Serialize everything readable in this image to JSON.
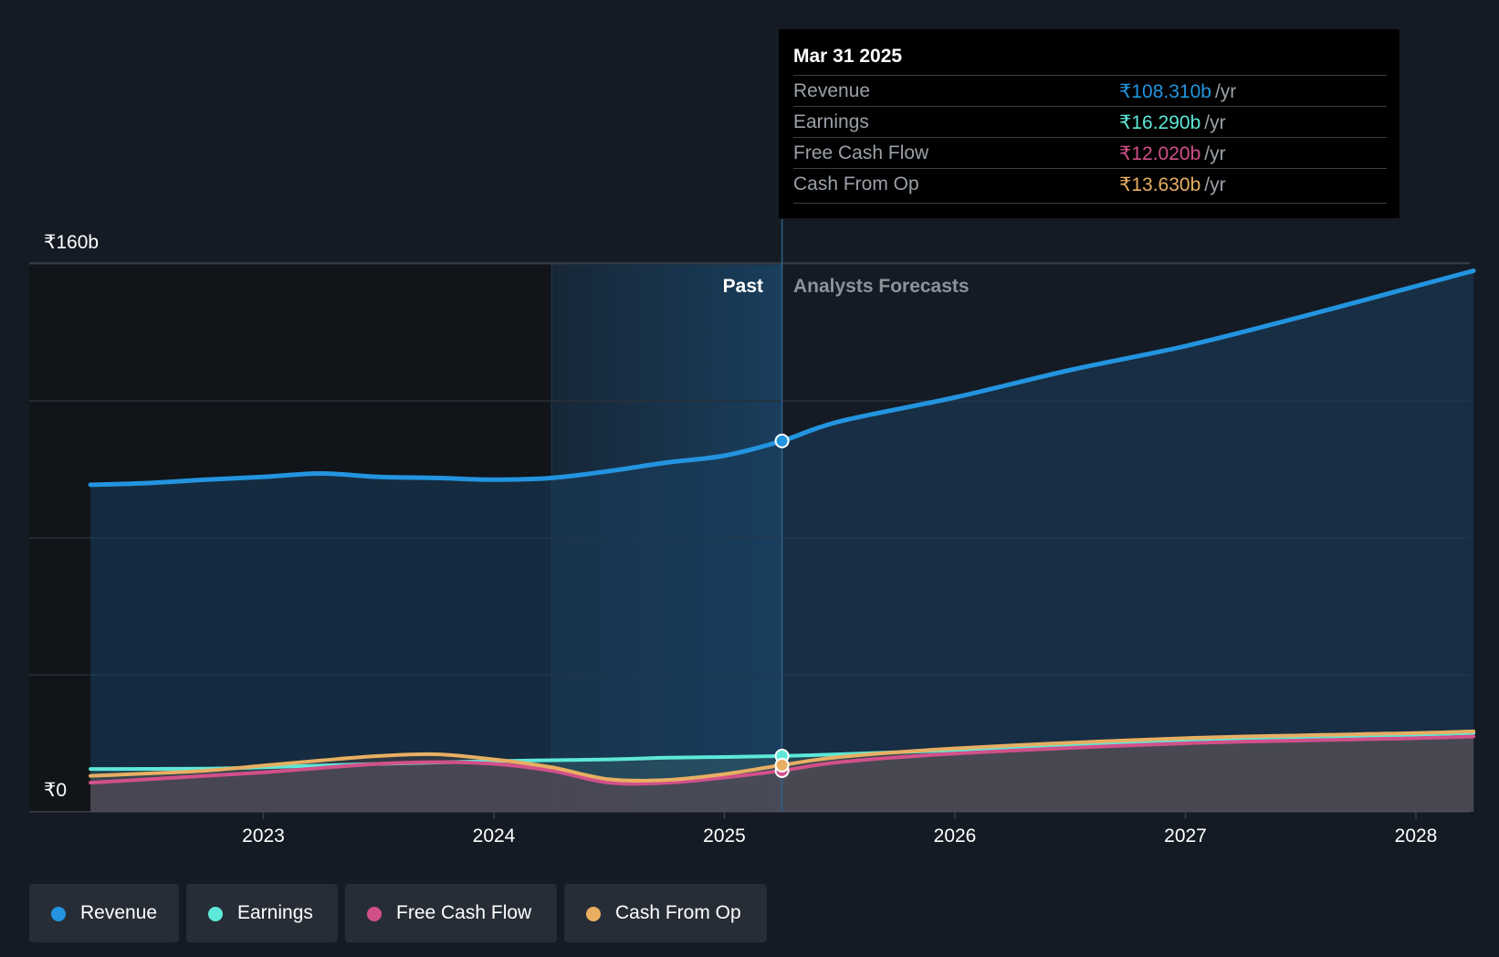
{
  "colors": {
    "revenue": "#2394df",
    "earnings": "#5ee8d9",
    "free_cash_flow": "#d2508a",
    "cash_from_op": "#e8af62",
    "background": "#151b24"
  },
  "tooltip": {
    "date": "Mar 31 2025",
    "rows": [
      {
        "label": "Revenue",
        "value": "₹108.310b",
        "unit": "/yr"
      },
      {
        "label": "Earnings",
        "value": "₹16.290b",
        "unit": "/yr"
      },
      {
        "label": "Free Cash Flow",
        "value": "₹12.020b",
        "unit": "/yr"
      },
      {
        "label": "Cash From Op",
        "value": "₹13.630b",
        "unit": "/yr"
      }
    ]
  },
  "sections": {
    "past": "Past",
    "forecast": "Analysts Forecasts"
  },
  "legend": [
    {
      "label": "Revenue"
    },
    {
      "label": "Earnings"
    },
    {
      "label": "Free Cash Flow"
    },
    {
      "label": "Cash From Op"
    }
  ],
  "chart_data": {
    "type": "area",
    "ylim": [
      0,
      160
    ],
    "y_tick_labels": [
      "₹0",
      "₹160b"
    ],
    "x_tick_labels": [
      "2023",
      "2024",
      "2025",
      "2026",
      "2027",
      "2028"
    ],
    "x_ticks": [
      2023,
      2024,
      2025,
      2026,
      2027,
      2028
    ],
    "xlim": [
      2022.0,
      2028.25
    ],
    "past_highlight_start": 2024.25,
    "divider": 2025.25,
    "grid": true,
    "legend_position": "bottom-left",
    "series": [
      {
        "name": "Revenue",
        "x": [
          2022.25,
          2022.5,
          2022.75,
          2023.0,
          2023.25,
          2023.5,
          2023.75,
          2024.0,
          2024.25,
          2024.5,
          2024.75,
          2025.0,
          2025.25,
          2025.5,
          2026.0,
          2026.5,
          2027.0,
          2027.5,
          2028.0,
          2028.25
        ],
        "y": [
          95.5,
          96.0,
          97.0,
          97.8,
          98.8,
          97.8,
          97.5,
          97.0,
          97.5,
          99.5,
          102.0,
          104.0,
          108.3,
          114.0,
          121.0,
          129.0,
          136.0,
          144.5,
          153.5,
          158.0
        ]
      },
      {
        "name": "Earnings",
        "x": [
          2022.25,
          2022.75,
          2023.0,
          2023.5,
          2024.0,
          2024.5,
          2024.75,
          2025.0,
          2025.25,
          2025.5,
          2026.0,
          2027.0,
          2028.0,
          2028.25
        ],
        "y": [
          12.5,
          12.6,
          13.0,
          14.0,
          14.8,
          15.3,
          15.8,
          16.0,
          16.29,
          16.8,
          18.0,
          20.5,
          22.5,
          23.0
        ]
      },
      {
        "name": "Free Cash Flow",
        "x": [
          2022.25,
          2022.5,
          2022.75,
          2023.0,
          2023.25,
          2023.5,
          2023.75,
          2024.0,
          2024.25,
          2024.5,
          2024.75,
          2025.0,
          2025.25,
          2025.5,
          2026.0,
          2027.0,
          2028.0,
          2028.25
        ],
        "y": [
          8.5,
          9.5,
          10.5,
          11.5,
          12.8,
          14.0,
          14.5,
          14.0,
          12.0,
          8.5,
          8.5,
          10.0,
          12.02,
          14.5,
          17.0,
          20.0,
          21.5,
          22.0
        ]
      },
      {
        "name": "Cash From Op",
        "x": [
          2022.25,
          2022.5,
          2022.75,
          2023.0,
          2023.25,
          2023.5,
          2023.75,
          2024.0,
          2024.25,
          2024.5,
          2024.75,
          2025.0,
          2025.25,
          2025.5,
          2026.0,
          2027.0,
          2028.0,
          2028.25
        ],
        "y": [
          10.5,
          11.2,
          12.0,
          13.5,
          15.0,
          16.3,
          16.8,
          15.3,
          13.0,
          9.5,
          9.3,
          11.0,
          13.63,
          16.0,
          18.5,
          21.5,
          23.0,
          23.5
        ]
      }
    ]
  }
}
